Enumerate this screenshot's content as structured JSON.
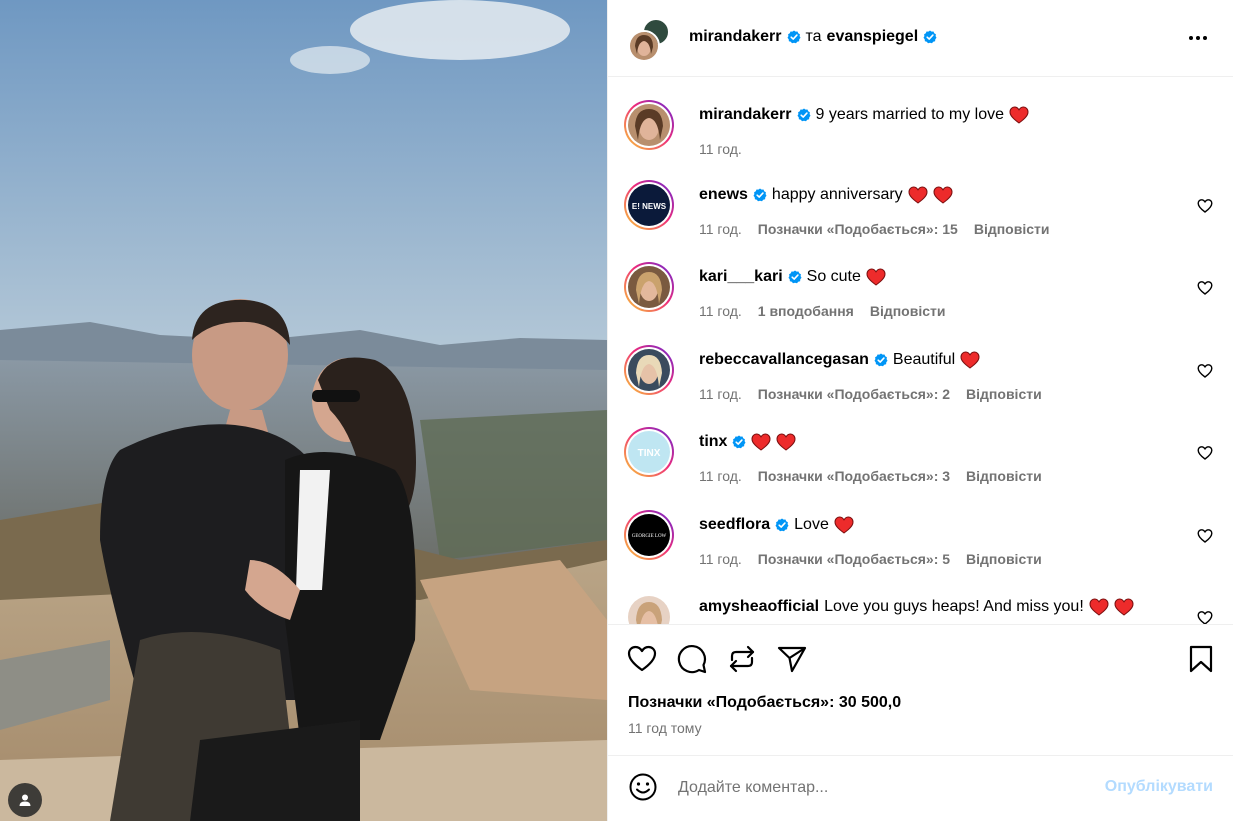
{
  "header": {
    "author": "mirandakerr",
    "conjunction": "та",
    "collaborator": "evanspiegel"
  },
  "caption": {
    "username": "mirandakerr",
    "text": "9 years married to my love",
    "emoji": "red-heart",
    "time": "11 год."
  },
  "comments": [
    {
      "username": "enews",
      "verified": true,
      "text": "happy anniversary",
      "hearts": 2,
      "time": "11 год.",
      "likes": "Позначки «Подобається»: 15",
      "reply": "Відповісти",
      "avatar_text": "E! NEWS"
    },
    {
      "username": "kari___kari",
      "verified": true,
      "text": "So cute",
      "hearts": 1,
      "time": "11 год.",
      "likes": "1 вподобання",
      "reply": "Відповісти",
      "avatar_text": ""
    },
    {
      "username": "rebeccavallancegasan",
      "verified": true,
      "text": "Beautiful",
      "hearts": 1,
      "time": "11 год.",
      "likes": "Позначки «Подобається»: 2",
      "reply": "Відповісти",
      "avatar_text": ""
    },
    {
      "username": "tinx",
      "verified": true,
      "text": "",
      "hearts": 2,
      "time": "11 год.",
      "likes": "Позначки «Подобається»: 3",
      "reply": "Відповісти",
      "avatar_text": "TINX"
    },
    {
      "username": "seedflora",
      "verified": true,
      "text": "Love",
      "hearts": 1,
      "time": "11 год.",
      "likes": "Позначки «Подобається»: 5",
      "reply": "Відповісти",
      "avatar_text": "GEORGIE LOW"
    },
    {
      "username": "amysheaofficial",
      "verified": false,
      "text": "Love you guys heaps! And miss you!",
      "hearts": 2,
      "time": "",
      "likes": "",
      "reply": "",
      "avatar_text": ""
    }
  ],
  "likes_summary": "Позначки «Подобається»: 30 500,0",
  "time_ago": "11 год тому",
  "comment_box": {
    "placeholder": "Додайте коментар...",
    "publish_label": "Опублікувати"
  },
  "colors": {
    "verified": "#0095f6",
    "heart": "#ed2b2b",
    "publish_disabled": "#b3dbff",
    "muted": "#737373"
  }
}
